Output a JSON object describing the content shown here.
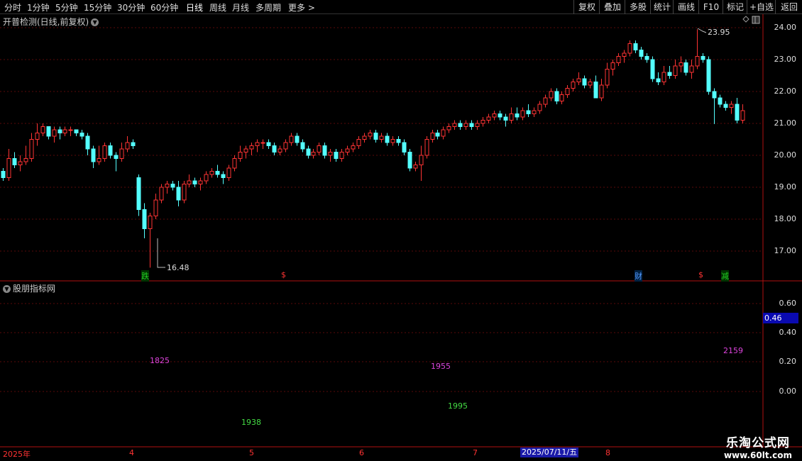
{
  "toolbar": {
    "periods": [
      "分时",
      "1分钟",
      "5分钟",
      "15分钟",
      "30分钟",
      "60分钟",
      "日线",
      "周线",
      "月线",
      "多周期",
      "更多 >"
    ],
    "buttons": [
      "复权",
      "叠加",
      "多股",
      "统计",
      "画线",
      "F10",
      "标记",
      "+自选",
      "返回"
    ]
  },
  "main_pane": {
    "title": "开普检测(日线,前复权)",
    "high_label": "23.95",
    "low_label": "16.48",
    "y_ticks": [
      "24.00",
      "23.00",
      "22.00",
      "21.00",
      "20.00",
      "19.00",
      "18.00",
      "17.00"
    ],
    "markers": [
      {
        "text": "跌",
        "color": "#22cc22"
      },
      {
        "text": "$",
        "color": "#ff3333"
      },
      {
        "text": "财",
        "color": "#5599ff"
      },
      {
        "text": "$",
        "color": "#ff3333"
      },
      {
        "text": "减",
        "color": "#22cc22"
      }
    ]
  },
  "indicator_pane": {
    "title": "股朋指标网",
    "y_ticks": [
      "0.60",
      "0.40",
      "0.20",
      "0.00"
    ],
    "current_value": "0.46",
    "labels": [
      {
        "text": "1825",
        "color": "#dd44dd"
      },
      {
        "text": "1938",
        "color": "#44dd44"
      },
      {
        "text": "1955",
        "color": "#dd44dd"
      },
      {
        "text": "1995",
        "color": "#44dd44"
      },
      {
        "text": "2159",
        "color": "#dd44dd"
      }
    ]
  },
  "date_axis": {
    "labels": [
      "2025年",
      "4",
      "5",
      "6",
      "7",
      "8"
    ],
    "cursor_date": "2025/07/11/五"
  },
  "watermark": {
    "title": "乐淘公式网",
    "url": "www.60lt.com"
  },
  "chart_data": {
    "type": "candlestick",
    "y_range": [
      16.2,
      24.2
    ],
    "up_color": "#ff3333",
    "down_color": "#54ffff",
    "ohlc": [
      [
        19.5,
        19.6,
        19.2,
        19.3
      ],
      [
        19.3,
        20.2,
        19.2,
        19.9
      ],
      [
        19.9,
        20.1,
        19.6,
        19.7
      ],
      [
        19.7,
        20.0,
        19.5,
        19.8
      ],
      [
        19.8,
        20.3,
        19.7,
        19.9
      ],
      [
        19.9,
        20.7,
        19.8,
        20.5
      ],
      [
        20.5,
        21.0,
        20.3,
        20.7
      ],
      [
        20.7,
        21.0,
        20.6,
        20.9
      ],
      [
        20.9,
        20.9,
        20.5,
        20.6
      ],
      [
        20.6,
        20.9,
        20.4,
        20.8
      ],
      [
        20.8,
        20.9,
        20.5,
        20.7
      ],
      [
        20.7,
        20.9,
        20.6,
        20.8
      ],
      [
        20.8,
        20.9,
        20.6,
        20.8
      ],
      [
        20.8,
        20.8,
        20.6,
        20.7
      ],
      [
        20.7,
        20.8,
        20.5,
        20.6
      ],
      [
        20.6,
        20.7,
        20.0,
        20.2
      ],
      [
        20.2,
        20.3,
        19.6,
        19.8
      ],
      [
        19.8,
        20.3,
        19.7,
        19.9
      ],
      [
        19.9,
        20.4,
        19.8,
        20.3
      ],
      [
        20.3,
        20.4,
        19.9,
        20.0
      ],
      [
        20.0,
        20.1,
        19.5,
        19.9
      ],
      [
        19.9,
        20.4,
        19.8,
        20.2
      ],
      [
        20.2,
        20.6,
        20.1,
        20.4
      ],
      [
        20.4,
        20.5,
        20.2,
        20.3
      ],
      [
        19.3,
        19.4,
        18.1,
        18.3
      ],
      [
        18.3,
        18.5,
        17.4,
        17.7
      ],
      [
        17.7,
        18.2,
        16.48,
        18.1
      ],
      [
        18.1,
        18.8,
        18.0,
        18.6
      ],
      [
        18.6,
        19.1,
        18.5,
        19.0
      ],
      [
        19.0,
        19.2,
        18.8,
        19.1
      ],
      [
        19.1,
        19.2,
        18.9,
        19.0
      ],
      [
        19.0,
        19.2,
        18.4,
        18.6
      ],
      [
        18.6,
        19.2,
        18.5,
        19.1
      ],
      [
        19.1,
        19.4,
        19.0,
        19.2
      ],
      [
        19.2,
        19.3,
        19.0,
        19.1
      ],
      [
        19.1,
        19.3,
        18.9,
        19.2
      ],
      [
        19.2,
        19.5,
        19.1,
        19.4
      ],
      [
        19.4,
        19.6,
        19.3,
        19.5
      ],
      [
        19.5,
        19.7,
        19.3,
        19.4
      ],
      [
        19.4,
        19.5,
        19.1,
        19.3
      ],
      [
        19.3,
        19.7,
        19.2,
        19.6
      ],
      [
        19.6,
        20.0,
        19.5,
        19.9
      ],
      [
        19.9,
        20.3,
        19.8,
        20.1
      ],
      [
        20.1,
        20.3,
        19.9,
        20.2
      ],
      [
        20.2,
        20.4,
        20.0,
        20.3
      ],
      [
        20.3,
        20.5,
        20.1,
        20.4
      ],
      [
        20.4,
        20.5,
        20.2,
        20.4
      ],
      [
        20.4,
        20.5,
        20.2,
        20.3
      ],
      [
        20.3,
        20.4,
        20.0,
        20.1
      ],
      [
        20.1,
        20.3,
        20.0,
        20.2
      ],
      [
        20.2,
        20.5,
        20.1,
        20.4
      ],
      [
        20.4,
        20.7,
        20.3,
        20.6
      ],
      [
        20.6,
        20.7,
        20.3,
        20.4
      ],
      [
        20.4,
        20.5,
        20.1,
        20.2
      ],
      [
        20.2,
        20.3,
        19.9,
        20.0
      ],
      [
        20.0,
        20.2,
        19.9,
        20.1
      ],
      [
        20.1,
        20.4,
        20.0,
        20.3
      ],
      [
        20.3,
        20.4,
        19.9,
        20.0
      ],
      [
        20.0,
        20.2,
        19.8,
        20.1
      ],
      [
        20.1,
        20.2,
        19.8,
        19.9
      ],
      [
        19.9,
        20.2,
        19.8,
        20.1
      ],
      [
        20.1,
        20.3,
        20.0,
        20.2
      ],
      [
        20.2,
        20.4,
        20.1,
        20.3
      ],
      [
        20.3,
        20.6,
        20.2,
        20.5
      ],
      [
        20.5,
        20.7,
        20.4,
        20.6
      ],
      [
        20.6,
        20.8,
        20.5,
        20.7
      ],
      [
        20.7,
        20.8,
        20.4,
        20.5
      ],
      [
        20.5,
        20.7,
        20.4,
        20.6
      ],
      [
        20.6,
        20.7,
        20.3,
        20.4
      ],
      [
        20.4,
        20.6,
        20.3,
        20.5
      ],
      [
        20.5,
        20.6,
        20.3,
        20.4
      ],
      [
        20.4,
        20.5,
        20.0,
        20.1
      ],
      [
        20.1,
        20.2,
        19.5,
        19.6
      ],
      [
        19.6,
        19.8,
        19.5,
        19.7
      ],
      [
        19.7,
        20.3,
        19.2,
        20.0
      ],
      [
        20.0,
        20.6,
        19.9,
        20.5
      ],
      [
        20.5,
        20.8,
        20.4,
        20.7
      ],
      [
        20.7,
        20.8,
        20.5,
        20.6
      ],
      [
        20.6,
        20.9,
        20.5,
        20.8
      ],
      [
        20.8,
        21.0,
        20.7,
        20.9
      ],
      [
        20.9,
        21.1,
        20.8,
        21.0
      ],
      [
        21.0,
        21.1,
        20.8,
        20.9
      ],
      [
        20.9,
        21.1,
        20.8,
        21.0
      ],
      [
        21.0,
        21.1,
        20.8,
        20.9
      ],
      [
        20.9,
        21.1,
        20.8,
        21.0
      ],
      [
        21.0,
        21.2,
        20.9,
        21.1
      ],
      [
        21.1,
        21.3,
        21.0,
        21.2
      ],
      [
        21.2,
        21.4,
        21.1,
        21.3
      ],
      [
        21.3,
        21.4,
        21.1,
        21.2
      ],
      [
        21.2,
        21.3,
        20.9,
        21.1
      ],
      [
        21.1,
        21.5,
        21.0,
        21.3
      ],
      [
        21.3,
        21.5,
        21.1,
        21.2
      ],
      [
        21.2,
        21.5,
        21.1,
        21.4
      ],
      [
        21.4,
        21.6,
        21.2,
        21.3
      ],
      [
        21.3,
        21.5,
        21.2,
        21.4
      ],
      [
        21.4,
        21.7,
        21.3,
        21.6
      ],
      [
        21.6,
        21.9,
        21.5,
        21.8
      ],
      [
        21.8,
        22.1,
        21.7,
        22.0
      ],
      [
        22.0,
        22.1,
        21.6,
        21.7
      ],
      [
        21.7,
        22.0,
        21.6,
        21.9
      ],
      [
        21.9,
        22.2,
        21.8,
        22.1
      ],
      [
        22.1,
        22.4,
        22.0,
        22.3
      ],
      [
        22.3,
        22.6,
        22.2,
        22.4
      ],
      [
        22.4,
        22.5,
        22.1,
        22.2
      ],
      [
        22.2,
        22.4,
        22.1,
        22.3
      ],
      [
        22.3,
        22.5,
        21.8,
        21.8
      ],
      [
        21.8,
        22.4,
        21.7,
        22.2
      ],
      [
        22.2,
        22.9,
        22.1,
        22.7
      ],
      [
        22.7,
        23.0,
        22.5,
        22.9
      ],
      [
        22.9,
        23.2,
        22.8,
        23.1
      ],
      [
        23.1,
        23.3,
        22.9,
        23.2
      ],
      [
        23.2,
        23.6,
        23.1,
        23.5
      ],
      [
        23.5,
        23.6,
        23.2,
        23.3
      ],
      [
        23.3,
        23.4,
        23.0,
        23.1
      ],
      [
        23.1,
        23.2,
        22.9,
        23.0
      ],
      [
        23.0,
        23.1,
        22.3,
        22.4
      ],
      [
        22.4,
        22.6,
        22.2,
        22.3
      ],
      [
        22.3,
        22.8,
        22.2,
        22.6
      ],
      [
        22.6,
        22.8,
        22.4,
        22.5
      ],
      [
        22.5,
        23.0,
        22.4,
        22.8
      ],
      [
        22.8,
        23.1,
        22.6,
        22.9
      ],
      [
        22.9,
        23.0,
        22.5,
        22.6
      ],
      [
        22.6,
        23.0,
        22.4,
        22.8
      ],
      [
        22.8,
        23.95,
        22.7,
        23.1
      ],
      [
        23.1,
        23.2,
        22.9,
        23.0
      ],
      [
        23.0,
        23.1,
        21.9,
        22.0
      ],
      [
        22.0,
        22.1,
        20.98,
        21.8
      ],
      [
        21.8,
        21.9,
        21.5,
        21.6
      ],
      [
        21.6,
        21.7,
        21.4,
        21.5
      ],
      [
        21.5,
        21.7,
        21.3,
        21.6
      ],
      [
        21.6,
        21.8,
        21.0,
        21.1
      ],
      [
        21.1,
        21.6,
        21.0,
        21.4
      ]
    ]
  }
}
